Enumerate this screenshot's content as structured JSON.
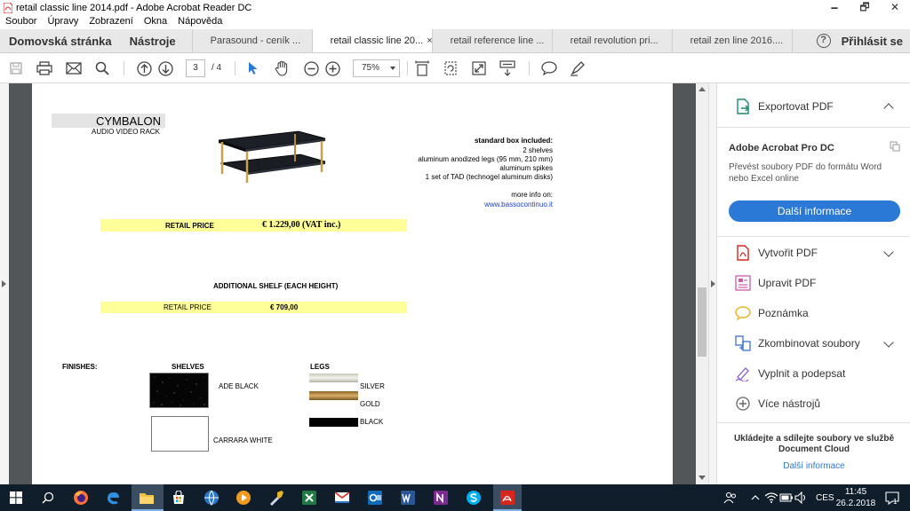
{
  "window": {
    "title": "retail classic line 2014.pdf - Adobe Acrobat Reader DC",
    "minimize": "🗕",
    "maximize": "🗗",
    "close": "✕"
  },
  "menu": [
    "Soubor",
    "Úpravy",
    "Zobrazení",
    "Okna",
    "Nápověda"
  ],
  "tabs": {
    "home": "Domovská stránka",
    "tools": "Nástroje",
    "docs": [
      {
        "label": "Parasound - ceník ...",
        "active": false
      },
      {
        "label": "retail classic line 20...",
        "active": true
      },
      {
        "label": "retail reference line ...",
        "active": false
      },
      {
        "label": "retail revolution pri...",
        "active": false
      },
      {
        "label": "retail zen line 2016....",
        "active": false
      }
    ],
    "help": "?",
    "signin": "Přihlásit se",
    "close_glyph": "×"
  },
  "toolbar": {
    "page_current": "3",
    "page_total": "/ 4",
    "zoom": "75%"
  },
  "pdf": {
    "product_name": "CYMBALON",
    "product_subtitle": "AUDIO VIDEO RACK",
    "box_title": "standard box included:",
    "box_lines": [
      "2 shelves",
      "aluminum anodized legs (95 mm, 210 mm)",
      "aluminum spikes",
      "1 set of TAD (technogel aluminum disks)"
    ],
    "more_info": "more info on:",
    "link": "www.bassocontinuo.it",
    "retail_label": "RETAIL PRICE",
    "retail_price": "€ 1.229,00 (VAT inc.)",
    "additional_title": "ADDITIONAL SHELF (EACH HEIGHT)",
    "additional_label": "RETAIL PRICE",
    "additional_price": "€ 709,00",
    "finishes_label": "FINISHES:",
    "shelves_label": "SHELVES",
    "legs_label": "LEGS",
    "shelf_finishes": [
      "ADE BLACK",
      "CARRARA WHITE"
    ],
    "leg_finishes": [
      "SILVER",
      "GOLD",
      "BLACK"
    ]
  },
  "side_panel": {
    "export": "Exportovat PDF",
    "product": "Adobe Acrobat Pro DC",
    "description": "Převést soubory PDF do formátu Word nebo Excel online",
    "cta": "Další informace",
    "tools": [
      "Vytvořit PDF",
      "Upravit PDF",
      "Poznámka",
      "Zkombinovat soubory",
      "Vyplnit a podepsat",
      "Více nástrojů"
    ],
    "cloud_note": "Ukládejte a sdílejte soubory ve službě Document Cloud",
    "cloud_link": "Další informace"
  },
  "taskbar": {
    "language": "CES",
    "time": "11:45",
    "date": "26.2.2018",
    "notifications": "1"
  },
  "colors": {
    "accent": "#2b79d7",
    "price_band": "#ffff99",
    "link": "#1a40c8",
    "acrobat_red": "#d9251c"
  }
}
